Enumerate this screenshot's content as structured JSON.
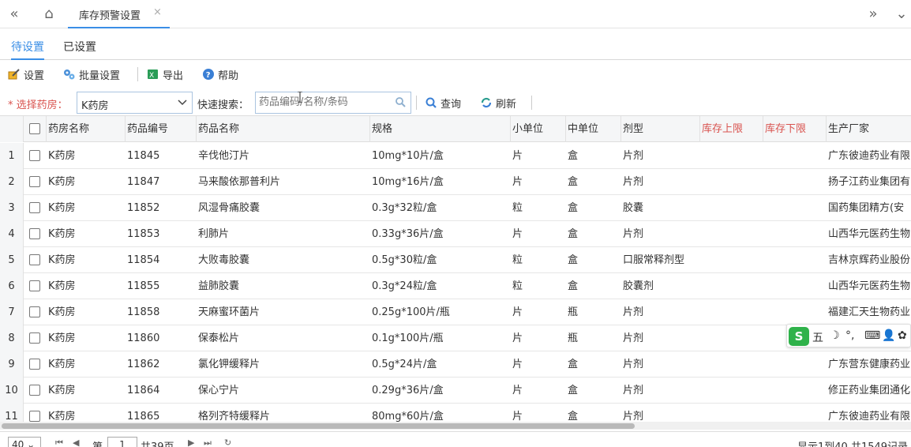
{
  "top": {
    "tab_title": "库存预警设置",
    "tab_close": "×",
    "nav_prev": "«",
    "nav_home": "⌂",
    "nav_next": "»",
    "nav_more": "⌄"
  },
  "subtabs": [
    "待设置",
    "已设置"
  ],
  "toolbar": {
    "settings": "设置",
    "batch": "批量设置",
    "export": "导出",
    "help": "帮助"
  },
  "filter": {
    "pharmacy_label": "* 选择药房：",
    "pharmacy_value": "K药房",
    "search_label": "快速搜索：",
    "search_placeholder": "药品编码/名称/条码",
    "query": "查询",
    "refresh": "刷新"
  },
  "columns": [
    "药房名称",
    "药品编号",
    "药品名称",
    "规格",
    "小单位",
    "中单位",
    "剂型",
    "库存上限",
    "库存下限",
    "生产厂家"
  ],
  "rows": [
    {
      "n": "1",
      "pharmacy": "K药房",
      "code": "11845",
      "name": "辛伐他汀片",
      "spec": "10mg*10片/盒",
      "unit_s": "片",
      "unit_m": "盒",
      "form": "片剂",
      "maker": "广东彼迪药业有限"
    },
    {
      "n": "2",
      "pharmacy": "K药房",
      "code": "11847",
      "name": "马来酸依那普利片",
      "spec": "10mg*16片/盒",
      "unit_s": "片",
      "unit_m": "盒",
      "form": "片剂",
      "maker": "扬子江药业集团有"
    },
    {
      "n": "3",
      "pharmacy": "K药房",
      "code": "11852",
      "name": "风湿骨痛胶囊",
      "spec": "0.3g*32粒/盒",
      "unit_s": "粒",
      "unit_m": "盒",
      "form": "胶囊",
      "maker": "国药集团精方(安"
    },
    {
      "n": "4",
      "pharmacy": "K药房",
      "code": "11853",
      "name": "利肺片",
      "spec": "0.33g*36片/盒",
      "unit_s": "片",
      "unit_m": "盒",
      "form": "片剂",
      "maker": "山西华元医药生物"
    },
    {
      "n": "5",
      "pharmacy": "K药房",
      "code": "11854",
      "name": "大败毒胶囊",
      "spec": "0.5g*30粒/盒",
      "unit_s": "粒",
      "unit_m": "盒",
      "form": "口服常释剂型",
      "maker": "吉林京辉药业股份"
    },
    {
      "n": "6",
      "pharmacy": "K药房",
      "code": "11855",
      "name": "益肺胶囊",
      "spec": "0.3g*24粒/盒",
      "unit_s": "粒",
      "unit_m": "盒",
      "form": "胶囊剂",
      "maker": "山西华元医药生物"
    },
    {
      "n": "7",
      "pharmacy": "K药房",
      "code": "11858",
      "name": "天麻蜜环菌片",
      "spec": "0.25g*100片/瓶",
      "unit_s": "片",
      "unit_m": "瓶",
      "form": "片剂",
      "maker": "福建汇天生物药业"
    },
    {
      "n": "8",
      "pharmacy": "K药房",
      "code": "11860",
      "name": "保泰松片",
      "spec": "0.1g*100片/瓶",
      "unit_s": "片",
      "unit_m": "瓶",
      "form": "片剂",
      "maker": ""
    },
    {
      "n": "9",
      "pharmacy": "K药房",
      "code": "11862",
      "name": "氯化钾缓释片",
      "spec": "0.5g*24片/盒",
      "unit_s": "片",
      "unit_m": "盒",
      "form": "片剂",
      "maker": "广东营东健康药业"
    },
    {
      "n": "10",
      "pharmacy": "K药房",
      "code": "11864",
      "name": "保心宁片",
      "spec": "0.29g*36片/盒",
      "unit_s": "片",
      "unit_m": "盒",
      "form": "片剂",
      "maker": "修正药业集团通化"
    },
    {
      "n": "11",
      "pharmacy": "K药房",
      "code": "11865",
      "name": "格列齐特缓释片",
      "spec": "80mg*60片/盒",
      "unit_s": "片",
      "unit_m": "盒",
      "form": "片剂",
      "maker": "广东彼迪药业有限"
    }
  ],
  "pager": {
    "page_size": "40",
    "page_label": "第",
    "page_value": "1",
    "page_total": "共39页",
    "summary": "显示1到40,共1549记录"
  },
  "ime": {
    "logo": "S",
    "mode": "五",
    "moon": "☽",
    "punct": "°,",
    "keyboard": "⌨",
    "user": "👤",
    "more": "✿"
  },
  "colors": {
    "accent": "#3a8ee6",
    "required": "#d9534f",
    "ime_green": "#2fb24a"
  }
}
